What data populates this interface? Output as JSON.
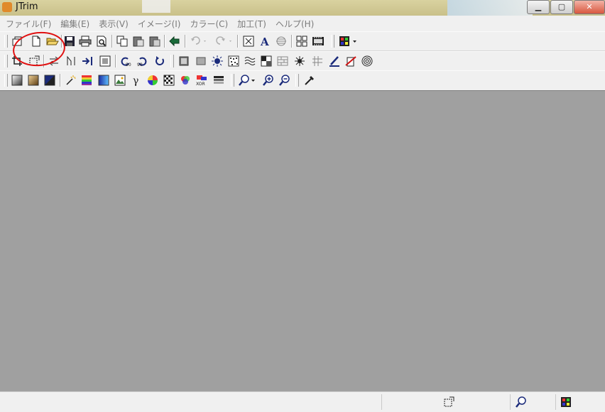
{
  "window": {
    "title": "JTrim",
    "accent": "#e01010"
  },
  "menubar": [
    {
      "label": "ファイル(F)"
    },
    {
      "label": "編集(E)"
    },
    {
      "label": "表示(V)"
    },
    {
      "label": "イメージ(I)"
    },
    {
      "label": "カラー(C)"
    },
    {
      "label": "加工(T)"
    },
    {
      "label": "ヘルプ(H)"
    }
  ],
  "toolbar1": [
    "toggle-panel-icon",
    "new-file-icon",
    "open-folder-icon",
    "save-icon",
    "print-icon",
    "print-preview-icon",
    "copy-icon",
    "paste-icon",
    "paste-new-icon",
    "clipboard-flow-icon",
    "undo-icon",
    "redo-icon",
    "fit-window-icon",
    "text-icon",
    "align-center-icon",
    "grid-view-icon",
    "filmstrip-icon",
    "color-grid-dropdown-icon"
  ],
  "toolbar2": [
    "crop-icon",
    "resize-icon",
    "flip-icon",
    "mirror-icon",
    "arrow-right-icon",
    "frame-icon",
    "rotate-left-90-icon",
    "rotate-right-90-icon",
    "rotate-free-icon",
    "emboss-icon",
    "relief-icon",
    "blur-icon",
    "noise-icon",
    "wave-icon",
    "mosaic-icon",
    "brick-icon",
    "spark-icon",
    "tile-icon",
    "brush-icon",
    "red-x-icon",
    "spiral-icon"
  ],
  "toolbar3": [
    "gradient-light-icon",
    "sepia-icon",
    "darken-icon",
    "magic-wand-icon",
    "rainbow-icon",
    "blue-gradient-icon",
    "picture-icon",
    "gamma-icon",
    "color-wheel-icon",
    "checker-icon",
    "rgb-icon",
    "xor-icon",
    "grayscale-icon",
    "zoom-dropdown-icon",
    "zoom-in-icon",
    "zoom-out-icon",
    "eyedropper-icon"
  ],
  "statusbar": [
    "resize-icon",
    "magnifier-icon",
    "color-grid-icon"
  ]
}
